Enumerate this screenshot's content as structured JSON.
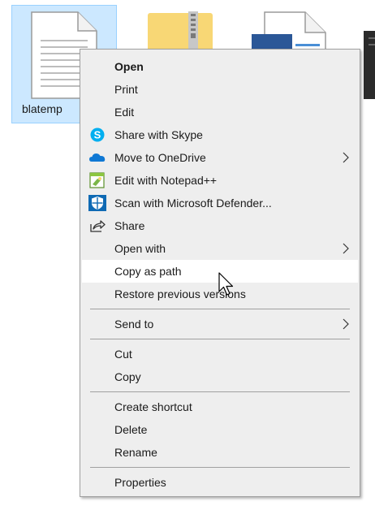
{
  "explorer": {
    "selected_file_label": "blatemp",
    "items": [
      {
        "name": "text-document-icon"
      },
      {
        "name": "zip-folder-icon"
      },
      {
        "name": "word-document-icon"
      }
    ]
  },
  "context_menu": {
    "items": [
      {
        "label": "Open",
        "bold": true
      },
      {
        "label": "Print"
      },
      {
        "label": "Edit"
      },
      {
        "label": "Share with Skype",
        "icon": "skype-icon"
      },
      {
        "label": "Move to OneDrive",
        "icon": "onedrive-icon",
        "submenu": true
      },
      {
        "label": "Edit with Notepad++",
        "icon": "notepad-plus-plus-icon"
      },
      {
        "label": "Scan with Microsoft Defender...",
        "icon": "defender-shield-icon"
      },
      {
        "label": "Share",
        "icon": "share-icon"
      },
      {
        "label": "Open with",
        "submenu": true
      },
      {
        "label": "Copy as path",
        "hovered": true
      },
      {
        "label": "Restore previous versions"
      },
      {
        "label": "Send to",
        "submenu": true
      },
      {
        "label": "Cut"
      },
      {
        "label": "Copy"
      },
      {
        "label": "Create shortcut"
      },
      {
        "label": "Delete"
      },
      {
        "label": "Rename"
      },
      {
        "label": "Properties"
      }
    ]
  },
  "colors": {
    "menu_bg": "#eeeeee",
    "hover_bg": "#ffffff",
    "selection_bg": "#cce8ff",
    "separator": "#a0a0a0"
  }
}
